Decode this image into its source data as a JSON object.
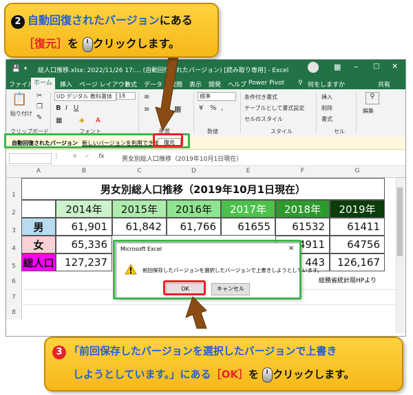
{
  "callout_top": {
    "number": "2",
    "line1_prefix": "自動回復されたバージョン",
    "line1_suffix": "にある",
    "line2_button": "［復元］",
    "line2_wo": "を",
    "line2_action": "クリックします。"
  },
  "callout_bottom": {
    "number": "3",
    "line1": "「前回保存したバージョンを選択したバージョンで上書き",
    "line2_prefix": "しようとしています。」にある",
    "line2_button": "［OK］",
    "line2_wo": "を",
    "line2_action": "クリックします。"
  },
  "window": {
    "title": "総人口推移.xlsx: 2022/11/26 17:… (自動回復されたバージョン) [読み取り専用] - Excel",
    "tabs": [
      "ファイル",
      "ホーム",
      "挿入",
      "ページ レイアウト",
      "数式",
      "データ",
      "校閲",
      "表示",
      "開発",
      "ヘルプ",
      "Power Pivot"
    ],
    "tell_me": "何をしますか",
    "share_label": "共有"
  },
  "ribbon": {
    "paste_label": "貼り付け",
    "clipboard_label": "クリップボード",
    "font_name": "UD デジタル 教科書体",
    "font_size": "18",
    "font_label": "フォント",
    "align_label": "配置",
    "number_format": "標準",
    "number_label": "数値",
    "cond_format": "条件付き書式",
    "table_format": "テーブルとして書式設定",
    "cell_style": "セルのスタイル",
    "style_label": "スタイル",
    "insert": "挿入",
    "delete": "削除",
    "format": "書式",
    "cells_label": "セル",
    "edit_label": "編集"
  },
  "notice": {
    "title": "自動回復されたバージョン",
    "message": "新しいバージョンを利用できます。",
    "restore_button": "復元"
  },
  "formula_bar": {
    "fx": "fx",
    "content": "男女別総人口推移（2019年10月1日現在）"
  },
  "columns": [
    "A",
    "B",
    "C",
    "D",
    "E",
    "F",
    "G"
  ],
  "rows": [
    "1",
    "2",
    "3",
    "4",
    "5",
    "6",
    "7",
    "8"
  ],
  "sheet": {
    "title": "男女別総人口推移（2019年10月1日現在）",
    "years": [
      "2014年",
      "2015年",
      "2016年",
      "2017年",
      "2018年",
      "2019年"
    ],
    "year_colors": [
      "#ccf3cc",
      "#adecad",
      "#8fe48f",
      "#4cc24c",
      "#2d9a2d",
      "#0b3d0b"
    ],
    "year_text_colors": [
      "#111111",
      "#111111",
      "#111111",
      "#ffffff",
      "#ffffff",
      "#ffffff"
    ],
    "row_labels": [
      "男",
      "女",
      "総人口"
    ],
    "row_label_colors": [
      "#b7dcef",
      "#fbd0d6",
      "#ff00ff"
    ],
    "male": [
      "61,901",
      "61,842",
      "61,766",
      "61655",
      "61532",
      "61411"
    ],
    "female": [
      "65,336",
      "",
      "",
      "",
      "4911",
      "64756"
    ],
    "total": [
      "127,237",
      "",
      "",
      "",
      "443",
      "126,167"
    ],
    "source": "総務省統計局HPより"
  },
  "dialog": {
    "title": "Microsoft Excel",
    "close": "×",
    "message": "前回保存したバージョンを選択したバージョンで上書きしようとしています。",
    "ok": "OK",
    "cancel": "キャンセル"
  },
  "colors": {
    "excel_green": "#217346",
    "callout_yellow": "#ffd23e",
    "highlight_red": "#ee1c25",
    "highlight_green": "#3cb54a"
  }
}
